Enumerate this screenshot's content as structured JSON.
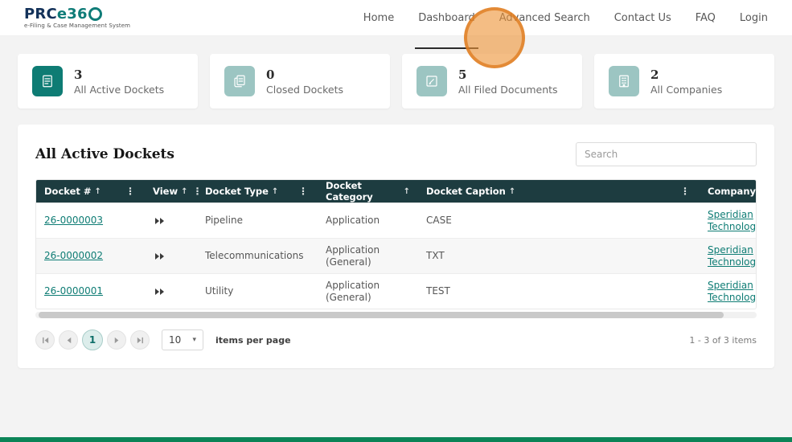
{
  "colors": {
    "accent_teal": "#0E7C74",
    "muted_icon_teal": "#9CC5C2",
    "table_header_bg": "#1D3C40",
    "link_teal": "#0E7C74",
    "click_indicator_orange": "#E98B36",
    "footer_bar_green": "#0B8457"
  },
  "header": {
    "logo": {
      "brand_prefix": "PRC",
      "brand_suffix": "e36",
      "tagline": "e-Filing & Case Management System"
    },
    "nav": [
      {
        "label": "Home"
      },
      {
        "label": "Dashboard"
      },
      {
        "label": "Advanced Search"
      },
      {
        "label": "Contact Us"
      },
      {
        "label": "FAQ"
      },
      {
        "label": "Login"
      }
    ]
  },
  "stats": [
    {
      "value": "3",
      "label": "All Active Dockets"
    },
    {
      "value": "0",
      "label": "Closed Dockets"
    },
    {
      "value": "5",
      "label": "All Filed Documents"
    },
    {
      "value": "2",
      "label": "All Companies"
    }
  ],
  "main": {
    "title": "All Active Dockets",
    "search": {
      "placeholder": "Search",
      "value": ""
    },
    "table": {
      "columns": [
        {
          "label": "Docket #"
        },
        {
          "label": "View"
        },
        {
          "label": "Docket Type"
        },
        {
          "label": "Docket Category"
        },
        {
          "label": "Docket Caption"
        },
        {
          "label": "Company"
        }
      ],
      "rows": [
        {
          "docket_number": "26-0000003",
          "docket_type": "Pipeline",
          "docket_category": "Application",
          "docket_caption": "CASE",
          "company": "Speridian Technologies"
        },
        {
          "docket_number": "26-0000002",
          "docket_type": "Telecommunications",
          "docket_category": "Application (General)",
          "docket_caption": "TXT",
          "company": "Speridian Technologies"
        },
        {
          "docket_number": "26-0000001",
          "docket_type": "Utility",
          "docket_category": "Application (General)",
          "docket_caption": "TEST",
          "company": "Speridian Technologies"
        }
      ]
    },
    "pagination": {
      "current_page": "1",
      "page_size": "10",
      "items_per_page_label": "items per page",
      "range_label": "1 - 3 of 3 items"
    }
  }
}
